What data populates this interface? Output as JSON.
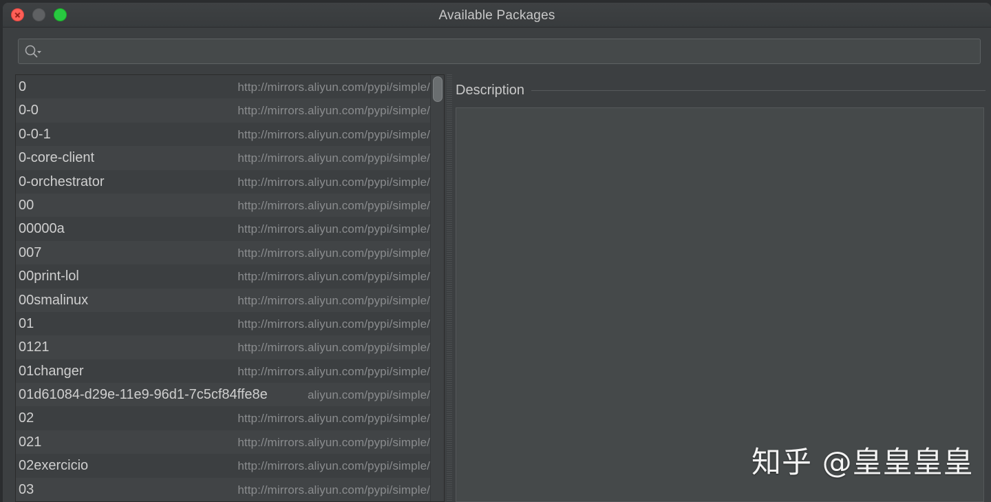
{
  "window": {
    "title": "Available Packages"
  },
  "search": {
    "value": "",
    "placeholder": ""
  },
  "packages": [
    {
      "name": "0",
      "repo": "http://mirrors.aliyun.com/pypi/simple/"
    },
    {
      "name": "0-0",
      "repo": "http://mirrors.aliyun.com/pypi/simple/"
    },
    {
      "name": "0-0-1",
      "repo": "http://mirrors.aliyun.com/pypi/simple/"
    },
    {
      "name": "0-core-client",
      "repo": "http://mirrors.aliyun.com/pypi/simple/"
    },
    {
      "name": "0-orchestrator",
      "repo": "http://mirrors.aliyun.com/pypi/simple/"
    },
    {
      "name": "00",
      "repo": "http://mirrors.aliyun.com/pypi/simple/"
    },
    {
      "name": "00000a",
      "repo": "http://mirrors.aliyun.com/pypi/simple/"
    },
    {
      "name": "007",
      "repo": "http://mirrors.aliyun.com/pypi/simple/"
    },
    {
      "name": "00print-lol",
      "repo": "http://mirrors.aliyun.com/pypi/simple/"
    },
    {
      "name": "00smalinux",
      "repo": "http://mirrors.aliyun.com/pypi/simple/"
    },
    {
      "name": "01",
      "repo": "http://mirrors.aliyun.com/pypi/simple/"
    },
    {
      "name": "0121",
      "repo": "http://mirrors.aliyun.com/pypi/simple/"
    },
    {
      "name": "01changer",
      "repo": "http://mirrors.aliyun.com/pypi/simple/"
    },
    {
      "name": "01d61084-d29e-11e9-96d1-7c5cf84ffe8e",
      "repo": "aliyun.com/pypi/simple/"
    },
    {
      "name": "02",
      "repo": "http://mirrors.aliyun.com/pypi/simple/"
    },
    {
      "name": "021",
      "repo": "http://mirrors.aliyun.com/pypi/simple/"
    },
    {
      "name": "02exercicio",
      "repo": "http://mirrors.aliyun.com/pypi/simple/"
    },
    {
      "name": "03",
      "repo": "http://mirrors.aliyun.com/pypi/simple/"
    }
  ],
  "description": {
    "label": "Description",
    "content": ""
  },
  "watermark": "知乎 @皇皇皇皇",
  "icons": {
    "close": "close-icon",
    "minimize": "minimize-icon",
    "maximize": "maximize-icon",
    "search": "search-icon"
  },
  "colors": {
    "background": "#3c3f41",
    "close": "#fe5f57",
    "maximize": "#28c840",
    "text": "#cfcfcf",
    "repo_text": "#8a8c8e"
  }
}
